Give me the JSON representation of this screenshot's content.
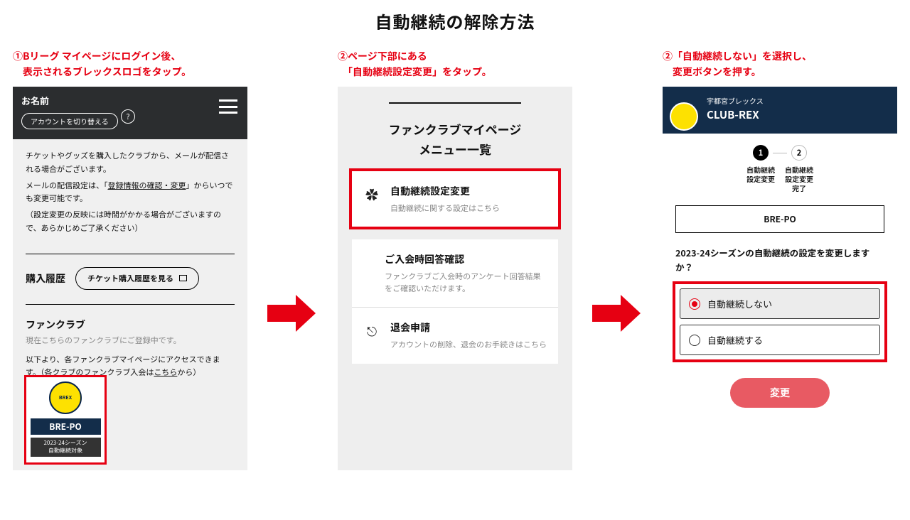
{
  "title": "自動継続の解除方法",
  "steps": {
    "s1": {
      "caption": "①Bリーグ マイページにログイン後、\n　表示されるブレックスロゴをタップ。",
      "name": "お名前",
      "switch_account": "アカウントを切り替える",
      "notice1": "チケットやグッズを購入したクラブから、メールが配信される場合がございます。",
      "notice2a": "メールの配信設定は、「",
      "notice2_link": "登録情報の確認・変更",
      "notice2b": "」からいつでも変更可能です。",
      "notice3": "（設定変更の反映には時間がかかる場合がございますので、あらかじめご了承ください）",
      "history_h": "購入履歴",
      "ticket_btn": "チケット購入履歴を見る",
      "fanclub_h": "ファンクラブ",
      "fanclub_sub": "現在こちらのファンクラブにご登録中です。",
      "fanclub_p_a": "以下より、各ファンクラブマイページにアクセスできます。（各クラブのファンクラブ入会は",
      "fanclub_p_link": "こちら",
      "fanclub_p_b": "から）",
      "brepo": "BRE-PO",
      "season": "2023-24シーズン\n自動継続対象"
    },
    "s2": {
      "caption": "②ページ下部にある\n　「自動継続設定変更」をタップ。",
      "menu_h": "ファンクラブマイページ\nメニュー一覧",
      "i1_t": "自動継続設定変更",
      "i1_d": "自動継続に関する設定はこちら",
      "i2_t": "ご入会時回答確認",
      "i2_d": "ファンクラブご入会時のアンケート回答結果をご確認いただけます。",
      "i3_t": "退会申請",
      "i3_d": "アカウントの削除、退会のお手続きはこちら"
    },
    "s3": {
      "caption": "②「自動継続しない」を選択し、\n　変更ボタンを押す。",
      "team": "宇都宮ブレックス",
      "club": "CLUB-REX",
      "step1_lbl": "自動継続\n設定変更",
      "step2_lbl": "自動継続\n設定変更\n完了",
      "brepo": "BRE-PO",
      "question": "2023-24シーズンの自動継続の設定を変更しますか？",
      "opt_no": "自動継続しない",
      "opt_yes": "自動継続する",
      "change": "変更"
    }
  }
}
